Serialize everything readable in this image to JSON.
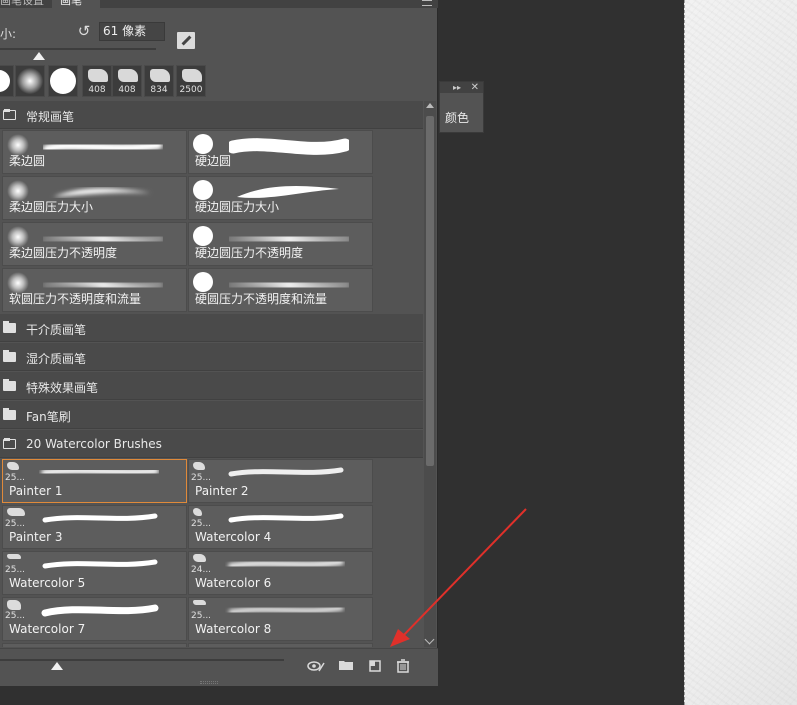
{
  "panel": {
    "tabs": [
      {
        "label": "画笔设置"
      },
      {
        "label": "画笔"
      }
    ]
  },
  "size": {
    "label": "小:",
    "value": "61 像素",
    "slider_fraction": 0.25
  },
  "presets": [
    {
      "kind": "soft",
      "num": ""
    },
    {
      "kind": "soft-large",
      "num": ""
    },
    {
      "kind": "hard",
      "num": ""
    },
    {
      "kind": "tip",
      "num": "408"
    },
    {
      "kind": "tip",
      "num": "408"
    },
    {
      "kind": "tip",
      "num": "834"
    },
    {
      "kind": "tip",
      "num": "2500"
    }
  ],
  "folders": {
    "f1": "常规画笔",
    "f2": "干介质画笔",
    "f3": "湿介质画笔",
    "f4": "特殊效果画笔",
    "f5": "Fan笔刷",
    "f6": "20 Watercolor Brushes"
  },
  "general_brushes": {
    "b1": "柔边圆",
    "b2": "硬边圆",
    "b3": "柔边圆压力大小",
    "b4": "硬边圆压力大小",
    "b5": "柔边圆压力不透明度",
    "b6": "硬边圆压力不透明度",
    "b7": "软圆压力不透明度和流量",
    "b8": "硬圆压力不透明度和流量"
  },
  "watercolor_brushes": {
    "w1": {
      "label": "Painter 1",
      "size": "25..."
    },
    "w2": {
      "label": "Painter 2",
      "size": "25..."
    },
    "w3": {
      "label": "Painter 3",
      "size": "25..."
    },
    "w4": {
      "label": "Watercolor 4",
      "size": "25..."
    },
    "w5": {
      "label": "Watercolor 5",
      "size": "25..."
    },
    "w6": {
      "label": "Watercolor 6",
      "size": "24..."
    },
    "w7": {
      "label": "Watercolor 7",
      "size": "25..."
    },
    "w8": {
      "label": "Watercolor 8",
      "size": "25..."
    }
  },
  "color_panel": {
    "label": "颜色"
  },
  "footer": {
    "preview_slider_fraction": 0.2
  },
  "colors": {
    "selection": "#e08a3a",
    "annotation": "#e0302a"
  }
}
